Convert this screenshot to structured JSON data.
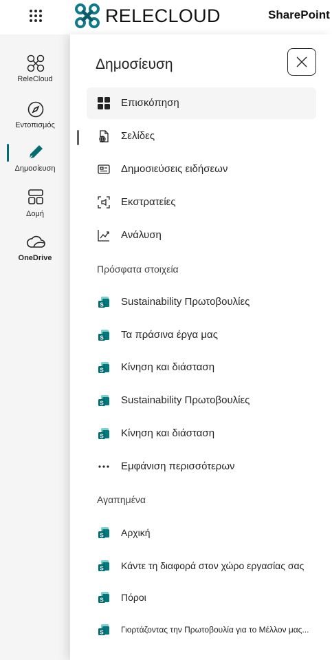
{
  "topbar": {
    "brand_name": "RELECLOUD",
    "app_name": "SharePoint",
    "waffle_icon": "app-launcher-icon",
    "brand_color": "#0f7b8a"
  },
  "rail": {
    "items": [
      {
        "label": "ReleCloud",
        "icon": "relecloud-logo-icon",
        "active": false
      },
      {
        "label": "Εντοπισμός",
        "icon": "compass-icon",
        "active": false
      },
      {
        "label": "Δημοσίευση",
        "icon": "pen-icon",
        "active": true
      },
      {
        "label": "Δομή",
        "icon": "layout-icon",
        "active": false
      },
      {
        "label": "OneDrive",
        "icon": "cloud-icon",
        "active": false
      }
    ],
    "accent_color": "#036c70"
  },
  "panel": {
    "title": "Δημοσίευση",
    "close_icon": "close-icon",
    "nav": [
      {
        "label": "Επισκόπηση",
        "icon": "grid-icon",
        "selected": true
      },
      {
        "label": "Σελίδες",
        "icon": "page-globe-icon",
        "selected": false
      },
      {
        "label": "Δημοσιεύσεις ειδήσεων",
        "icon": "news-icon",
        "selected": false
      },
      {
        "label": "Εκστρατείες",
        "icon": "campaign-icon",
        "selected": false
      },
      {
        "label": "Ανάλυση",
        "icon": "analytics-icon",
        "selected": false
      }
    ],
    "recent": {
      "heading": "Πρόσφατα στοιχεία",
      "items": [
        {
          "label": "Sustainability Πρωτοβουλίες",
          "icon": "sharepoint-site-icon"
        },
        {
          "label": "Τα πράσινα έργα μας",
          "icon": "sharepoint-site-icon"
        },
        {
          "label": "Κίνηση και διάσταση",
          "icon": "sharepoint-site-icon"
        },
        {
          "label": "Sustainability Πρωτοβουλίες",
          "icon": "sharepoint-site-icon"
        },
        {
          "label": "Κίνηση και διάσταση",
          "icon": "sharepoint-site-icon"
        }
      ],
      "show_more": "Εμφάνιση περισσότερων"
    },
    "favorites": {
      "heading": "Αγαπημένα",
      "items": [
        {
          "label": "Αρχική",
          "icon": "sharepoint-site-icon"
        },
        {
          "label": "Κάντε τη διαφορά στον χώρο εργασίας σας",
          "icon": "sharepoint-site-icon"
        },
        {
          "label": "Πόροι",
          "icon": "sharepoint-site-icon"
        },
        {
          "label": "Γιορτάζοντας την Πρωτοβουλία για το Μέλλον μας...",
          "icon": "sharepoint-site-icon"
        }
      ]
    }
  }
}
